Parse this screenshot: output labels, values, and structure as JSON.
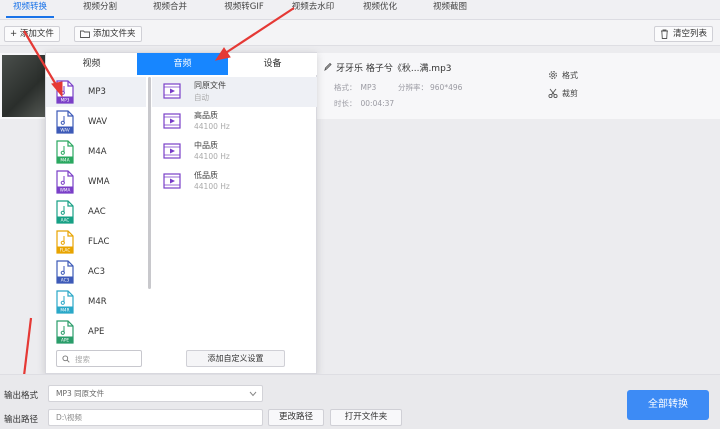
{
  "tabs": [
    {
      "label": "视频转换",
      "active": true
    },
    {
      "label": "视频分割"
    },
    {
      "label": "视频合并"
    },
    {
      "label": "视频转GIF"
    },
    {
      "label": "视频去水印"
    },
    {
      "label": "视频优化"
    },
    {
      "label": "视频截图"
    }
  ],
  "toolbar": {
    "add_file": "+ 添加文件",
    "add_folder": "添加文件夹",
    "clear_list": "清空列表"
  },
  "file": {
    "name": "牙牙乐 格子兮《秋...满.mp3",
    "format_label": "格式：",
    "format_value": "MP3",
    "resolution_label": "分辨率：",
    "resolution_value": "960*496",
    "duration_label": "时长：",
    "duration_value": "00:04:37",
    "format_action": "格式",
    "cut_action": "裁剪"
  },
  "popup": {
    "tabs": [
      "视频",
      "音频",
      "设备"
    ],
    "active_tab": "音频",
    "formats": [
      "MP3",
      "WAV",
      "M4A",
      "WMA",
      "AAC",
      "FLAC",
      "AC3",
      "M4R",
      "APE"
    ],
    "format_colors": [
      "#7a3fc8",
      "#3d5ab8",
      "#2aa860",
      "#7a3fc8",
      "#17a085",
      "#e8a400",
      "#3d5ab8",
      "#2aa8c8",
      "#2a9d6a"
    ],
    "selected_format": "MP3",
    "qualities": [
      {
        "name": "同原文件",
        "sub": "自动"
      },
      {
        "name": "高品质",
        "sub": "44100 Hz"
      },
      {
        "name": "中品质",
        "sub": "44100 Hz"
      },
      {
        "name": "低品质",
        "sub": "44100 Hz"
      }
    ],
    "search_placeholder": "搜索",
    "custom_button": "添加自定义设置"
  },
  "bottom": {
    "output_format_label": "输出格式",
    "output_format_value": "MP3  同原文件",
    "output_path_label": "输出路径",
    "output_path_value": "D:\\视频",
    "change_path": "更改路径",
    "open_folder": "打开文件夹",
    "convert_all": "全部转换"
  },
  "colors": {
    "accent": "#1786ff",
    "arrow": "#e53935"
  }
}
